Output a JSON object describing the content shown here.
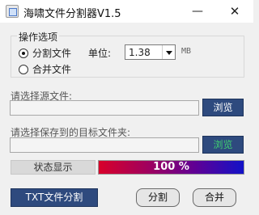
{
  "window": {
    "title": "海啸文件分割器V1.5",
    "minimize": "—",
    "close": "✕"
  },
  "options": {
    "group_title": "操作选项",
    "split_label": "分割文件",
    "merge_label": "合并文件",
    "selected": "split",
    "unit_label": "单位:",
    "unit_value": "1.38",
    "unit_suffix": "MB"
  },
  "source": {
    "label": "请选择源文件:",
    "value": "",
    "browse_label": "浏览"
  },
  "target": {
    "label": "请选择保存到的目标文件夹:",
    "value": "",
    "browse_label": "浏览",
    "browse_text_color": "#3fd070"
  },
  "status": {
    "label": "状态显示",
    "progress_text": "100 %",
    "progress_fraction": 1.0
  },
  "buttons": {
    "txt_split": "TXT文件分割",
    "split": "分割",
    "merge": "合并"
  }
}
